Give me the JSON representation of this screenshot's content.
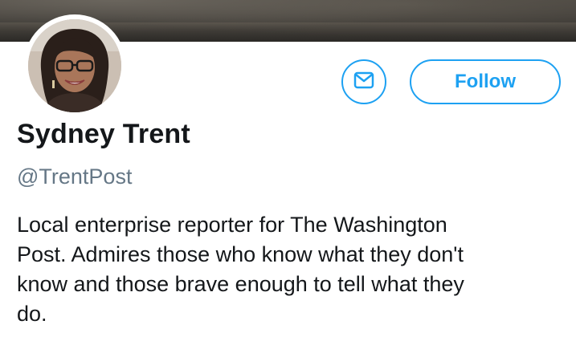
{
  "profile": {
    "name": "Sydney Trent",
    "handle": "@TrentPost",
    "bio_lines": [
      "Local enterprise reporter for The Washington",
      "Post. Admires those who know what they don't",
      "know and those brave enough to tell what they",
      "do."
    ]
  },
  "actions": {
    "follow_label": "Follow",
    "message_icon": "envelope-icon"
  },
  "colors": {
    "accent": "#1da1f2",
    "name_text": "#14171a",
    "handle_text": "#657786"
  }
}
